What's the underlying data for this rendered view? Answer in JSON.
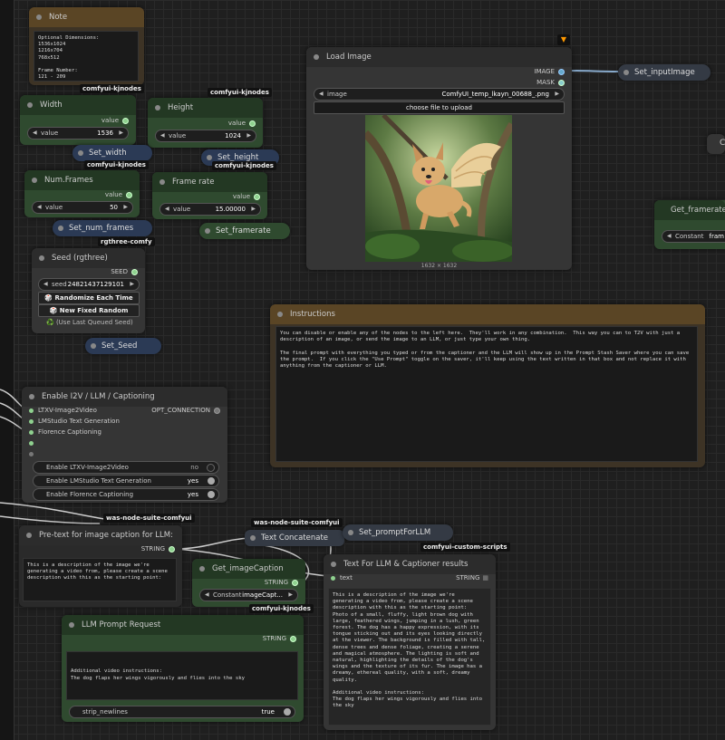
{
  "note": {
    "title": "Note",
    "text": "Optional Dimensions:\n1536x1024\n1216x704\n768x512\n\nFrame Number:\n121 - 209",
    "tag": "comfyui-kjnodes"
  },
  "width_node": {
    "title": "Width",
    "output": "value",
    "widget_label": "value",
    "widget_value": "1536"
  },
  "height_node": {
    "title": "Height",
    "output": "value",
    "widget_label": "value",
    "widget_value": "1024",
    "tag": "comfyui-kjnodes"
  },
  "set_width": {
    "label": "Set_width",
    "tag": "comfyui-kjnodes"
  },
  "set_height": {
    "label": "Set_height",
    "tag": "comfyui-kjnodes"
  },
  "num_frames": {
    "title": "Num.Frames",
    "output": "value",
    "widget_label": "value",
    "widget_value": "50"
  },
  "frame_rate": {
    "title": "Frame rate",
    "output": "value",
    "widget_label": "value",
    "widget_value": "15.00000"
  },
  "set_num_frames": {
    "label": "Set_num_frames",
    "tag": "rgthree-comfy"
  },
  "set_framerate": {
    "label": "Set_framerate"
  },
  "seed": {
    "title": "Seed (rgthree)",
    "output": "SEED",
    "widget_label": "seed",
    "widget_value": "24821437129101",
    "btn_random": "🎲 Randomize Each Time",
    "btn_fixed": "🎲 New Fixed Random",
    "btn_last": "♻️ (Use Last Queued Seed)"
  },
  "set_seed": {
    "label": "Set_Seed"
  },
  "load_image": {
    "title": "Load Image",
    "out_image": "IMAGE",
    "out_mask": "MASK",
    "widget_label": "image",
    "widget_value": "ComfyUI_temp_lkayn_00688_.png",
    "upload": "choose file to upload",
    "size": "1632 × 1632"
  },
  "set_input_image": {
    "label": "Set_inputImage"
  },
  "get_framerate": {
    "title": "Get_framerate",
    "widget_label": "Constant",
    "widget_value": "fram"
  },
  "instructions": {
    "title": "Instructions",
    "text": "You can disable or enable any of the nodes to the left here.  They'll work in any combination.  This way you can to T2V with just a description of an image, or send the image to an LLM, or just type your own thing.\n\nThe final prompt with everything you typed or from the captioner and the LLM will show up in the Prompt Stash Saver where you can save the prompt.  If you click the \"Use Prompt\" toggle on the saver, it'll keep using the text written in that box and not replace it with anything from the captioner or LLM."
  },
  "enable": {
    "title": "Enable I2V / LLM / Captioning",
    "output": "OPT_CONNECTION",
    "inputs": [
      "LTXV-Image2Video",
      "LMStudio Text Generation",
      "Florence Captioning",
      "",
      ""
    ],
    "toggles": [
      {
        "label": "Enable LTXV-Image2Video",
        "value": "no"
      },
      {
        "label": "Enable LMStudio Text Generation",
        "value": "yes"
      },
      {
        "label": "Enable Florence Captioning",
        "value": "yes"
      }
    ],
    "tag": "was-node-suite-comfyui"
  },
  "pretext": {
    "title": "Pre-text for image caption for LLM:",
    "output": "STRING",
    "text": "This is a description of the image we're generating a video from, please create a scene description with this as the starting point:"
  },
  "text_concat": {
    "title": "Text Concatenate",
    "tag": "was-node-suite-comfyui"
  },
  "set_prompt": {
    "label": "Set_promptForLLM",
    "tag": "comfyui-custom-scripts"
  },
  "get_caption": {
    "title": "Get_imageCaption",
    "output": "STRING",
    "widget_label": "Constant",
    "widget_value": "imageCapt...",
    "tag": "comfyui-kjnodes"
  },
  "text_for_llm": {
    "title": "Text For LLM & Captioner results",
    "input": "text",
    "output": "STRING",
    "text": "This is a description of the image we're generating a video from, please create a scene description with this as the starting point:\nPhoto of a small, fluffy, light brown dog with large, feathered wings, jumping in a lush, green forest. The dog has a happy expression, with its tongue sticking out and its eyes looking directly at the viewer. The background is filled with tall, dense trees and dense foliage, creating a serene and magical atmosphere. The lighting is soft and natural, highlighting the details of the dog's wings and the texture of its fur. The image has a dreamy, ethereal quality, with a soft, dreamy quality.\n\nAdditional video instructions:\nThe dog flaps her wings vigorously and flies into the sky"
  },
  "llm_prompt": {
    "title": "LLM Prompt Request",
    "output": "STRING",
    "text": "\n\nAdditional video instructions:\nThe dog flaps her wings vigorously and flies into the sky",
    "toggle_label": "strip_newlines",
    "toggle_value": "true"
  },
  "partial_right": {
    "letter": "C"
  }
}
